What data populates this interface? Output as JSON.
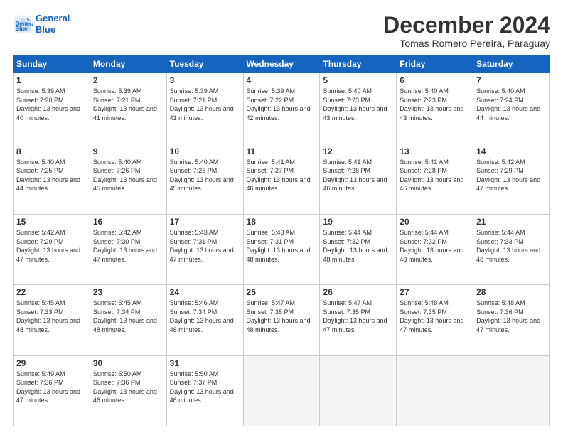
{
  "logo": {
    "line1": "General",
    "line2": "Blue"
  },
  "title": "December 2024",
  "location": "Tomas Romero Pereira, Paraguay",
  "days_of_week": [
    "Sunday",
    "Monday",
    "Tuesday",
    "Wednesday",
    "Thursday",
    "Friday",
    "Saturday"
  ],
  "weeks": [
    [
      {
        "day": "1",
        "sunrise": "5:39 AM",
        "sunset": "7:20 PM",
        "daylight": "13 hours and 40 minutes."
      },
      {
        "day": "2",
        "sunrise": "5:39 AM",
        "sunset": "7:21 PM",
        "daylight": "13 hours and 41 minutes."
      },
      {
        "day": "3",
        "sunrise": "5:39 AM",
        "sunset": "7:21 PM",
        "daylight": "13 hours and 41 minutes."
      },
      {
        "day": "4",
        "sunrise": "5:39 AM",
        "sunset": "7:22 PM",
        "daylight": "13 hours and 42 minutes."
      },
      {
        "day": "5",
        "sunrise": "5:40 AM",
        "sunset": "7:23 PM",
        "daylight": "13 hours and 43 minutes."
      },
      {
        "day": "6",
        "sunrise": "5:40 AM",
        "sunset": "7:23 PM",
        "daylight": "13 hours and 43 minutes."
      },
      {
        "day": "7",
        "sunrise": "5:40 AM",
        "sunset": "7:24 PM",
        "daylight": "13 hours and 44 minutes."
      }
    ],
    [
      {
        "day": "8",
        "sunrise": "5:40 AM",
        "sunset": "7:25 PM",
        "daylight": "13 hours and 44 minutes."
      },
      {
        "day": "9",
        "sunrise": "5:40 AM",
        "sunset": "7:26 PM",
        "daylight": "13 hours and 45 minutes."
      },
      {
        "day": "10",
        "sunrise": "5:40 AM",
        "sunset": "7:26 PM",
        "daylight": "13 hours and 45 minutes."
      },
      {
        "day": "11",
        "sunrise": "5:41 AM",
        "sunset": "7:27 PM",
        "daylight": "13 hours and 46 minutes."
      },
      {
        "day": "12",
        "sunrise": "5:41 AM",
        "sunset": "7:28 PM",
        "daylight": "13 hours and 46 minutes."
      },
      {
        "day": "13",
        "sunrise": "5:41 AM",
        "sunset": "7:28 PM",
        "daylight": "13 hours and 46 minutes."
      },
      {
        "day": "14",
        "sunrise": "5:42 AM",
        "sunset": "7:29 PM",
        "daylight": "13 hours and 47 minutes."
      }
    ],
    [
      {
        "day": "15",
        "sunrise": "5:42 AM",
        "sunset": "7:29 PM",
        "daylight": "13 hours and 47 minutes."
      },
      {
        "day": "16",
        "sunrise": "5:42 AM",
        "sunset": "7:30 PM",
        "daylight": "13 hours and 47 minutes."
      },
      {
        "day": "17",
        "sunrise": "5:43 AM",
        "sunset": "7:31 PM",
        "daylight": "13 hours and 47 minutes."
      },
      {
        "day": "18",
        "sunrise": "5:43 AM",
        "sunset": "7:31 PM",
        "daylight": "13 hours and 48 minutes."
      },
      {
        "day": "19",
        "sunrise": "5:44 AM",
        "sunset": "7:32 PM",
        "daylight": "13 hours and 48 minutes."
      },
      {
        "day": "20",
        "sunrise": "5:44 AM",
        "sunset": "7:32 PM",
        "daylight": "13 hours and 48 minutes."
      },
      {
        "day": "21",
        "sunrise": "5:44 AM",
        "sunset": "7:33 PM",
        "daylight": "13 hours and 48 minutes."
      }
    ],
    [
      {
        "day": "22",
        "sunrise": "5:45 AM",
        "sunset": "7:33 PM",
        "daylight": "13 hours and 48 minutes."
      },
      {
        "day": "23",
        "sunrise": "5:45 AM",
        "sunset": "7:34 PM",
        "daylight": "13 hours and 48 minutes."
      },
      {
        "day": "24",
        "sunrise": "5:46 AM",
        "sunset": "7:34 PM",
        "daylight": "13 hours and 48 minutes."
      },
      {
        "day": "25",
        "sunrise": "5:47 AM",
        "sunset": "7:35 PM",
        "daylight": "13 hours and 48 minutes."
      },
      {
        "day": "26",
        "sunrise": "5:47 AM",
        "sunset": "7:35 PM",
        "daylight": "13 hours and 47 minutes."
      },
      {
        "day": "27",
        "sunrise": "5:48 AM",
        "sunset": "7:35 PM",
        "daylight": "13 hours and 47 minutes."
      },
      {
        "day": "28",
        "sunrise": "5:48 AM",
        "sunset": "7:36 PM",
        "daylight": "13 hours and 47 minutes."
      }
    ],
    [
      {
        "day": "29",
        "sunrise": "5:49 AM",
        "sunset": "7:36 PM",
        "daylight": "13 hours and 47 minutes."
      },
      {
        "day": "30",
        "sunrise": "5:50 AM",
        "sunset": "7:36 PM",
        "daylight": "13 hours and 46 minutes."
      },
      {
        "day": "31",
        "sunrise": "5:50 AM",
        "sunset": "7:37 PM",
        "daylight": "13 hours and 46 minutes."
      },
      null,
      null,
      null,
      null
    ]
  ]
}
